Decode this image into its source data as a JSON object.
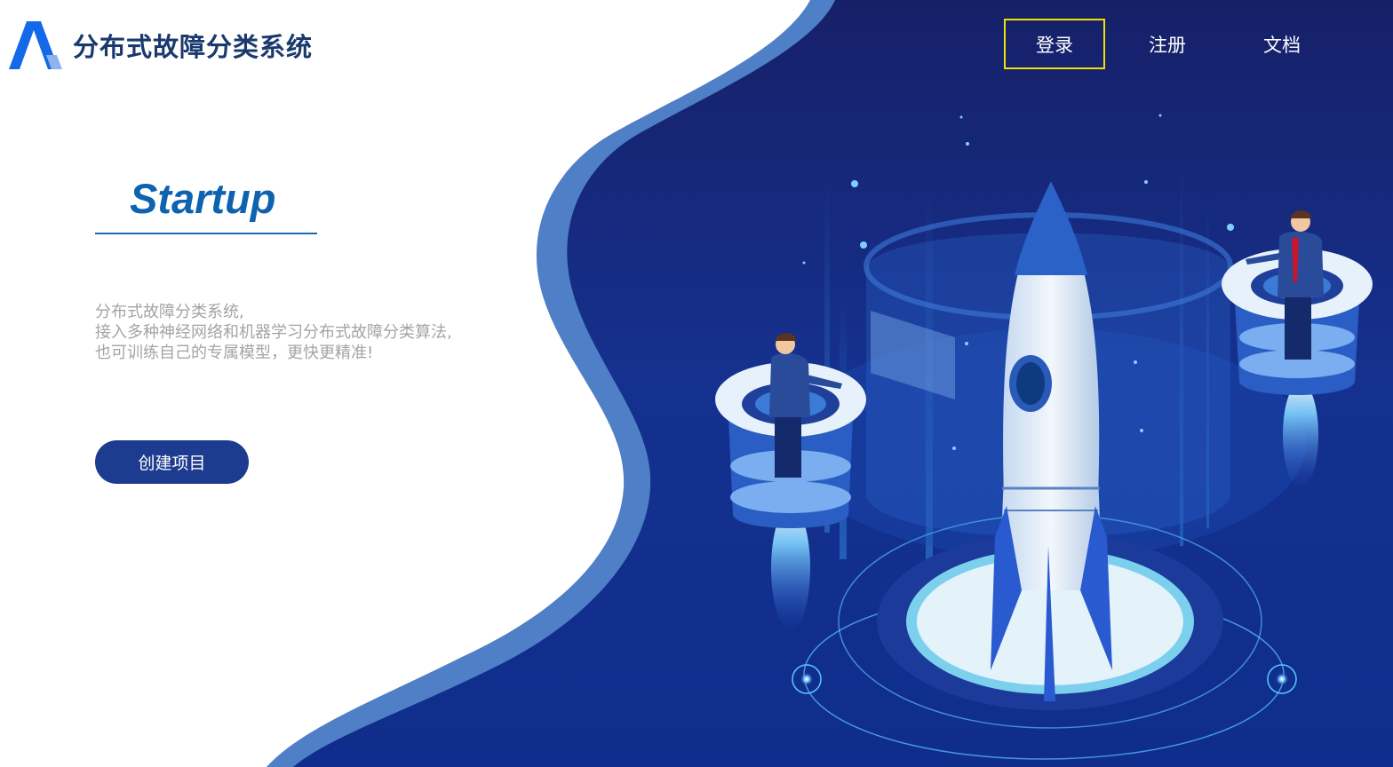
{
  "header": {
    "brand": "分布式故障分类系统",
    "nav": [
      {
        "label": "登录",
        "active": true
      },
      {
        "label": "注册",
        "active": false
      },
      {
        "label": "文档",
        "active": false
      }
    ]
  },
  "hero": {
    "title": "Startup",
    "description": [
      "分布式故障分类系统,",
      "接入多种神经网络和机器学习分布式故障分类算法,",
      "也可训练自己的专属模型，更快更精准!"
    ],
    "cta_label": "创建项目"
  },
  "colors": {
    "bg_dark": "#12237a",
    "bg_mid": "#1a3aa0",
    "accent_yellow": "#f1e000",
    "title_blue": "#0e62b0",
    "button_blue": "#1e3c8f"
  },
  "icons": [
    "logo-a-icon",
    "rocket-illustration",
    "person-left-illustration",
    "person-right-illustration"
  ]
}
